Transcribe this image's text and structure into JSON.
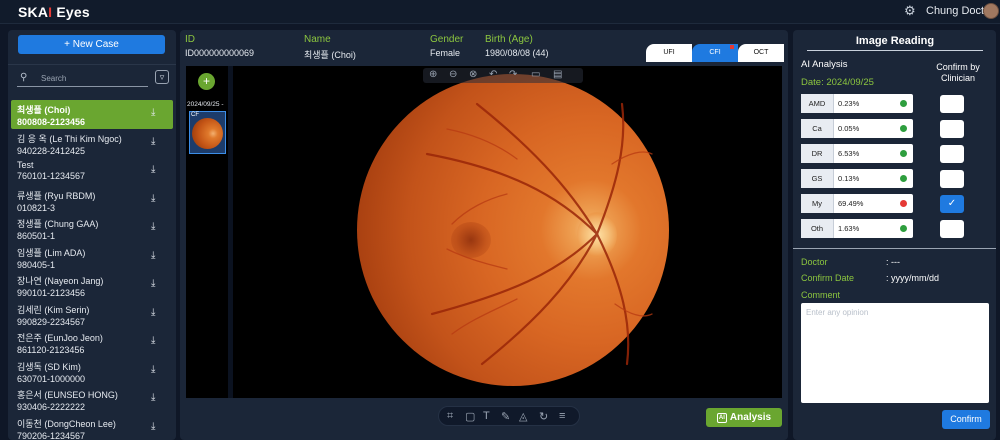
{
  "app": {
    "logo_prefix": "SKA",
    "logo_dot": "I",
    "logo_suffix": " Eyes",
    "user_name": "Chung Doctor"
  },
  "sidebar": {
    "new_case_label": "+ New Case",
    "search_placeholder": "Search",
    "patients": [
      {
        "name": "최생플 (Choi)",
        "id": "800808-2123456",
        "active": true
      },
      {
        "name": "김 응 옥 (Le Thi Kim Ngoc)",
        "id": "940228-2412425"
      },
      {
        "name": "Test",
        "id": "760101-1234567"
      },
      {
        "name": "류생플 (Ryu RBDM)",
        "id": "010821-3"
      },
      {
        "name": "정생플 (Chung GAA)",
        "id": "860501-1"
      },
      {
        "name": "임생플 (Lim ADA)",
        "id": "980405-1"
      },
      {
        "name": "장나연 (Nayeon Jang)",
        "id": "990101-2123456"
      },
      {
        "name": "김세린 (Kim Serin)",
        "id": "990829-2234567"
      },
      {
        "name": "전은주 (EunJoo Jeon)",
        "id": "861120-2123456"
      },
      {
        "name": "김생독 (SD Kim)",
        "id": "630701-1000000"
      },
      {
        "name": "홍은서 (EUNSEO HONG)",
        "id": "930406-2222222"
      },
      {
        "name": "이동천 (DongCheon Lee)",
        "id": "790206-1234567"
      }
    ]
  },
  "header": {
    "id_label": "ID",
    "id_value": "ID000000000069",
    "name_label": "Name",
    "name_value": "최생플 (Choi)",
    "gender_label": "Gender",
    "gender_value": "Female",
    "birth_label": "Birth (Age)",
    "birth_value": "1980/08/08 (44)"
  },
  "tabs": [
    {
      "label": "UFI",
      "active": false
    },
    {
      "label": "CFI",
      "active": true
    },
    {
      "label": "OCT",
      "active": false
    }
  ],
  "viewer": {
    "thumb_date": "2024/09/25 -",
    "thumb_label": "CF",
    "analysis_label": "Analysis"
  },
  "reading": {
    "title": "Image Reading",
    "ai_label": "AI Analysis",
    "date_text": "Date: 2024/09/25",
    "confirm_header": "Confirm by Clinician",
    "results": [
      {
        "code": "AMD",
        "pct": "0.23%",
        "status": "#2e9e3e",
        "confirmed": false
      },
      {
        "code": "Ca",
        "pct": "0.05%",
        "status": "#2e9e3e",
        "confirmed": false
      },
      {
        "code": "DR",
        "pct": "6.53%",
        "status": "#2e9e3e",
        "confirmed": false
      },
      {
        "code": "GS",
        "pct": "0.13%",
        "status": "#2e9e3e",
        "confirmed": false
      },
      {
        "code": "My",
        "pct": "69.49%",
        "status": "#e53935",
        "confirmed": true
      },
      {
        "code": "Oth",
        "pct": "1.63%",
        "status": "#2e9e3e",
        "confirmed": false
      }
    ],
    "doctor_label": "Doctor",
    "doctor_value": ": ---",
    "confirm_date_label": "Confirm Date",
    "confirm_date_value": ": yyyy/mm/dd",
    "comment_label": "Comment",
    "comment_placeholder": "Enter any opinion",
    "confirm_button": "Confirm"
  },
  "colors": {
    "accent_blue": "#1f7ae0",
    "accent_green": "#6aa630",
    "label_green": "#8cc63f"
  }
}
